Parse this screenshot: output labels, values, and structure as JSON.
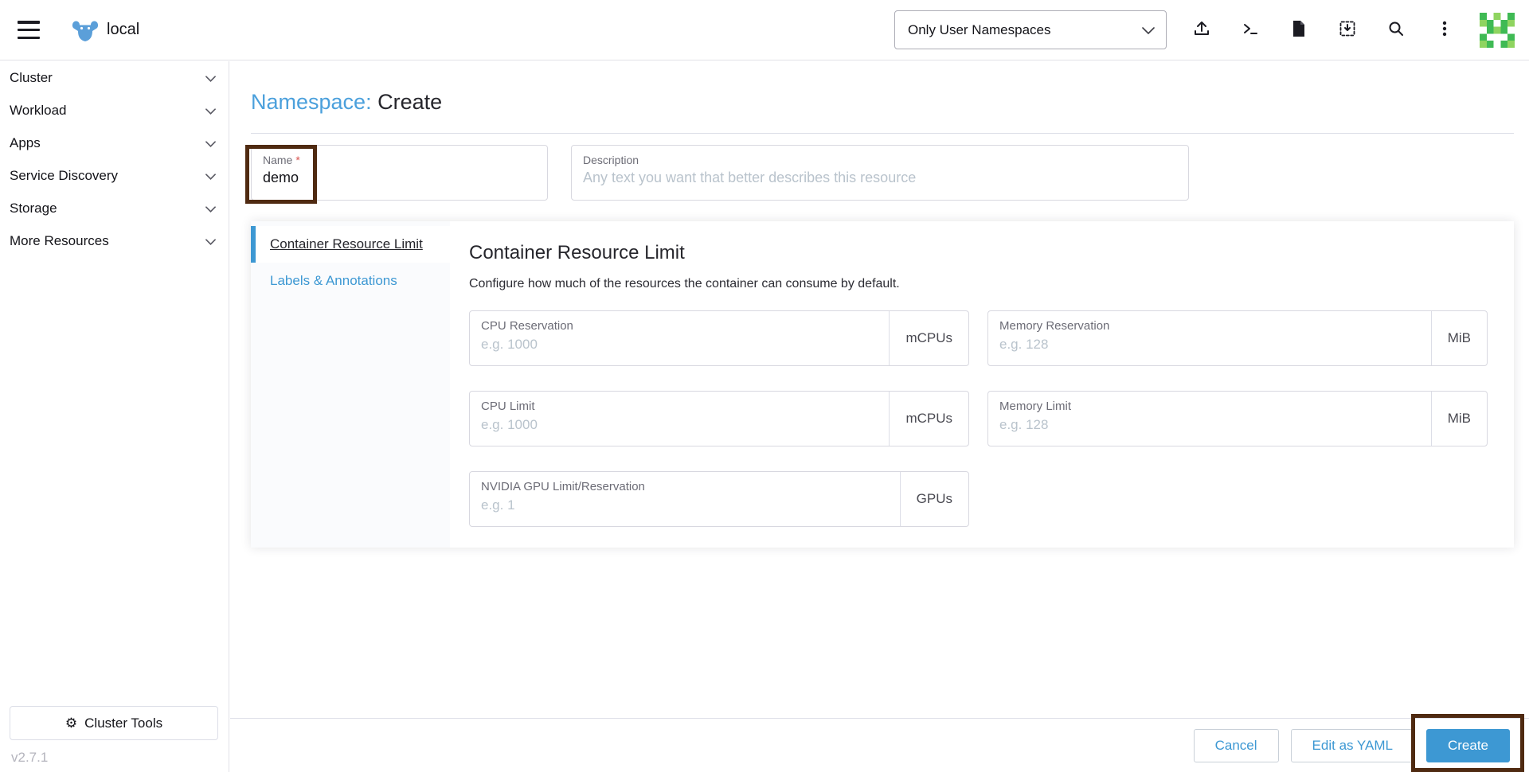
{
  "header": {
    "cluster_name": "local",
    "filter_dropdown": {
      "value": "Only User Namespaces"
    }
  },
  "sidebar": {
    "items": [
      {
        "label": "Cluster"
      },
      {
        "label": "Workload"
      },
      {
        "label": "Apps"
      },
      {
        "label": "Service Discovery"
      },
      {
        "label": "Storage"
      },
      {
        "label": "More Resources"
      }
    ],
    "cluster_tools": "Cluster Tools",
    "version": "v2.7.1"
  },
  "page": {
    "title_resource": "Namespace:",
    "title_mode": "Create"
  },
  "form": {
    "name": {
      "label": "Name",
      "required": "*",
      "value": "demo"
    },
    "description": {
      "label": "Description",
      "placeholder": "Any text you want that better describes this resource"
    }
  },
  "tabs": {
    "items": [
      {
        "label": "Container Resource Limit",
        "active": true
      },
      {
        "label": "Labels & Annotations",
        "active": false
      }
    ]
  },
  "resource_limit": {
    "heading": "Container Resource Limit",
    "subheading": "Configure how much of the resources the container can consume by default.",
    "fields": [
      {
        "label": "CPU Reservation",
        "placeholder": "e.g. 1000",
        "unit": "mCPUs"
      },
      {
        "label": "Memory Reservation",
        "placeholder": "e.g. 128",
        "unit": "MiB"
      },
      {
        "label": "CPU Limit",
        "placeholder": "e.g. 1000",
        "unit": "mCPUs"
      },
      {
        "label": "Memory Limit",
        "placeholder": "e.g. 128",
        "unit": "MiB"
      },
      {
        "label": "NVIDIA GPU Limit/Reservation",
        "placeholder": "e.g. 1",
        "unit": "GPUs"
      }
    ]
  },
  "actions": {
    "cancel": "Cancel",
    "edit_yaml": "Edit as YAML",
    "create": "Create"
  },
  "icons": {
    "gear": "⚙"
  },
  "colors": {
    "accent": "#3d98d3",
    "annotation": "#4f2a11",
    "link": "#4ba0dc"
  }
}
